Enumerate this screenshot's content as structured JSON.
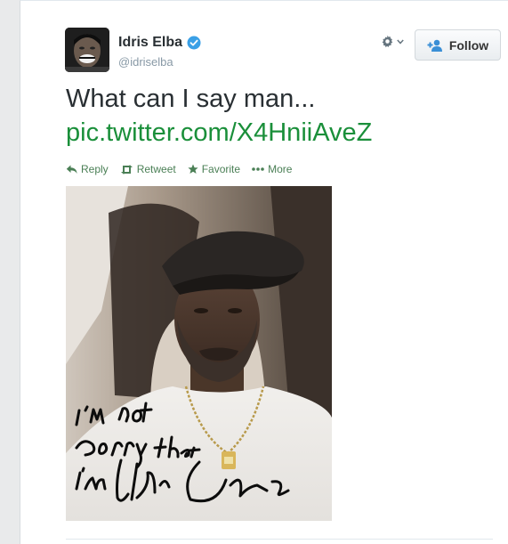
{
  "tweet": {
    "name": "Idris Elba",
    "handle": "@idriselba",
    "text": "What can I say man...",
    "link": "pic.twitter.com/X4HniiAveZ"
  },
  "header": {
    "follow_label": "Follow"
  },
  "actions": {
    "reply": "Reply",
    "retweet": "Retweet",
    "favorite": "Favorite",
    "more": "More"
  },
  "photo": {
    "signature_text": "I'm not sorry that I'm Idris Elba"
  },
  "colors": {
    "link": "#1a8f3a",
    "action": "#4a7f55",
    "verified": "#3aa0e6"
  },
  "icons": [
    "verified-badge-icon",
    "gear-icon",
    "chevron-down-icon",
    "add-user-icon",
    "reply-icon",
    "retweet-icon",
    "favorite-star-icon",
    "more-dots-icon"
  ]
}
